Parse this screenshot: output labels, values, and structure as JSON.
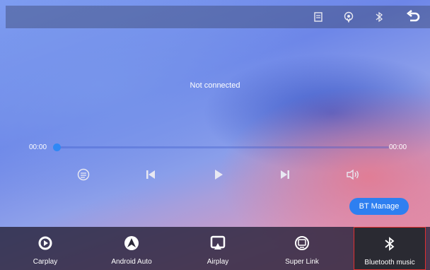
{
  "topbar": {
    "icons": [
      "document-icon",
      "podcast-icon",
      "bluetooth-icon",
      "back-icon"
    ]
  },
  "player": {
    "status": "Not connected",
    "elapsed": "00:00",
    "total": "00:00",
    "progress": 0,
    "controls": [
      "playlist-icon",
      "previous-icon",
      "play-icon",
      "next-icon",
      "volume-icon"
    ]
  },
  "bt_manage_label": "BT Manage",
  "nav": {
    "items": [
      {
        "label": "Carplay",
        "icon": "carplay-icon"
      },
      {
        "label": "Android Auto",
        "icon": "android-auto-icon"
      },
      {
        "label": "Airplay",
        "icon": "airplay-icon"
      },
      {
        "label": "Super Link",
        "icon": "super-link-icon"
      },
      {
        "label": "Bluetooth music",
        "icon": "bluetooth-icon",
        "active": true
      }
    ]
  },
  "colors": {
    "accent": "#2e7ff0",
    "active_border": "#e03030",
    "bottom_bar": "#2a2838"
  }
}
